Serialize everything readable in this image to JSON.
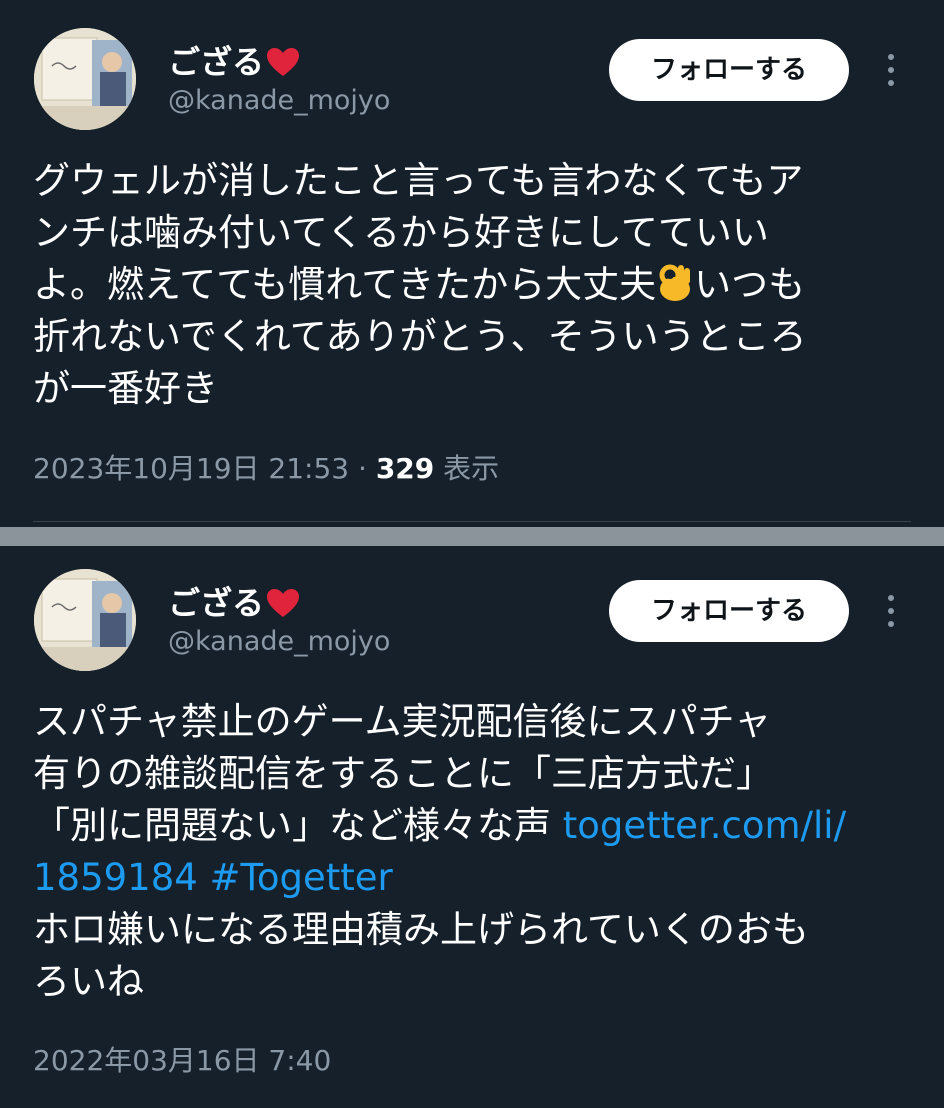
{
  "colors": {
    "background": "#15202b",
    "text": "#ffffff",
    "secondary_text": "#8b98a5",
    "link": "#1d9bf0",
    "follow_button_bg": "#ffffff",
    "separator": "#8b949a"
  },
  "tweets": [
    {
      "display_name": "ござる",
      "name_emoji": "red-heart-icon",
      "handle": "@kanade_mojyo",
      "follow_label": "フォローする",
      "menu_icon": "more-vertical-icon",
      "text_lines": [
        "グウェルが消したこと言っても言わなくてもア",
        "ンチは噛み付いてくるから好きにしてていい",
        "よ。燃えてても慣れてきたから大丈夫",
        "いつも",
        "折れないでくれてありがとう、そういうところ",
        "が一番好き"
      ],
      "inline_emoji": "ok-hand-icon",
      "timestamp": "2023年10月19日 21:53 · ",
      "views_count": "329",
      "views_label": " 表示"
    },
    {
      "display_name": "ござる",
      "name_emoji": "red-heart-icon",
      "handle": "@kanade_mojyo",
      "follow_label": "フォローする",
      "menu_icon": "more-vertical-icon",
      "text_lines": [
        "スパチャ禁止のゲーム実況配信後にスパチャ",
        "有りの雑談配信をすることに「三店方式だ」",
        "「別に問題ない」など様々な声 ",
        "togetter.com/li/",
        "1859184 #Togetter",
        "ホロ嫌いになる理由積み上げられていくのおも",
        "ろいね"
      ],
      "timestamp": "2022年03月16日 7:40"
    }
  ]
}
